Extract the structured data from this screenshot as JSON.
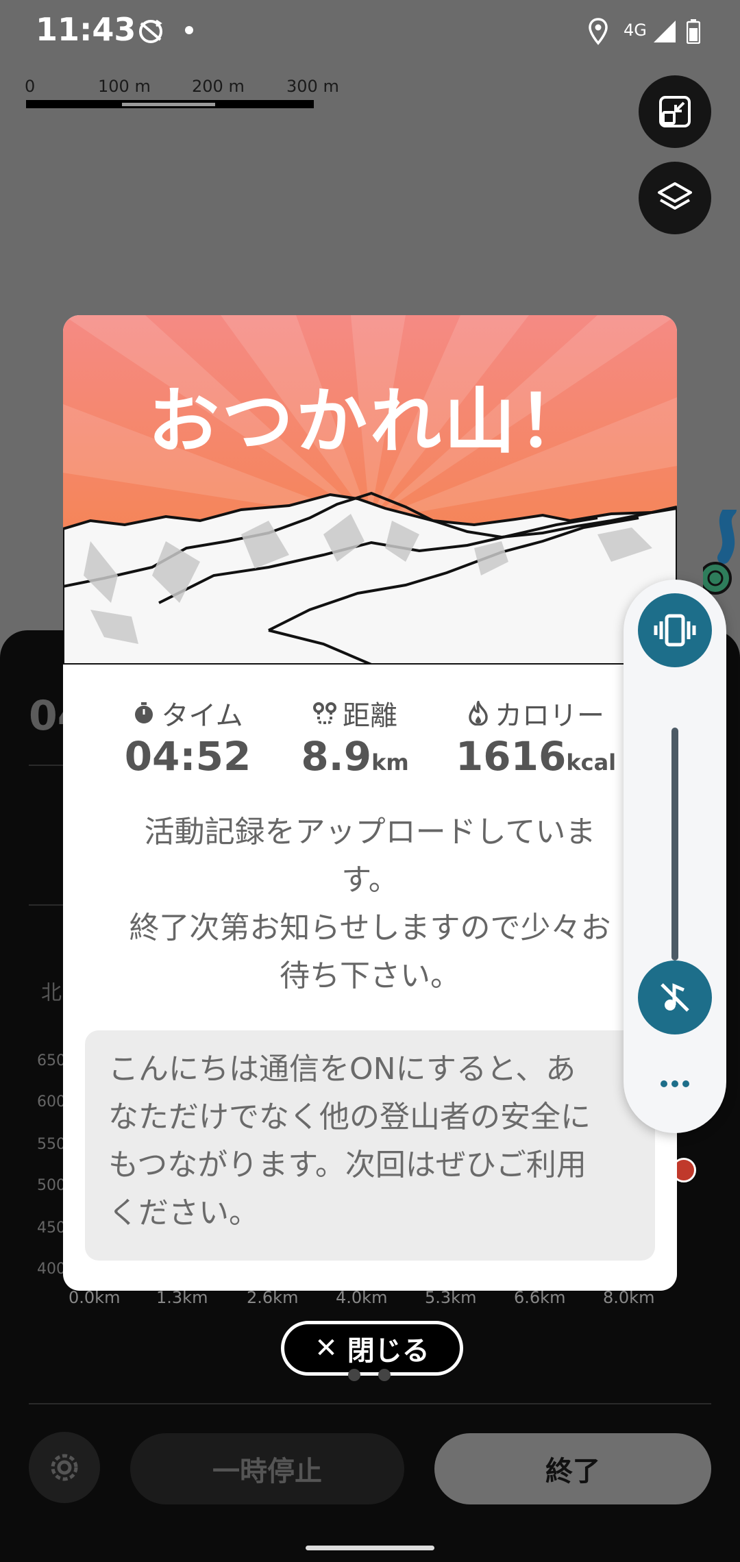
{
  "status_bar": {
    "time": "11:43",
    "network": "4G",
    "icons": [
      "sync-icon",
      "notification-dot",
      "location-icon",
      "signal-icon",
      "battery-icon"
    ]
  },
  "map": {
    "scale_labels": [
      "0",
      "100 m",
      "200 m",
      "300 m"
    ],
    "buttons": [
      "expand-icon",
      "layers-icon"
    ]
  },
  "background_panel": {
    "time_partial": "04",
    "north_label": "北",
    "y_axis_labels": [
      "650",
      "600",
      "550",
      "500",
      "450",
      "400"
    ],
    "x_axis_labels": [
      "0.0km",
      "1.3km",
      "2.6km",
      "4.0km",
      "5.3km",
      "6.6km",
      "8.0km"
    ],
    "pause_label": "一時停止",
    "end_label": "終了"
  },
  "modal": {
    "title": "おつかれ山！",
    "stats": [
      {
        "icon": "timer-icon",
        "label": "タイム",
        "value": "04:52",
        "unit": ""
      },
      {
        "icon": "distance-icon",
        "label": "距離",
        "value": "8.9",
        "unit": "km"
      },
      {
        "icon": "calorie-icon",
        "label": "カロリー",
        "value": "1616",
        "unit": "kcal"
      }
    ],
    "upload_message_lines": [
      "活動記録をアップロードしていま",
      "す。",
      "終了次第お知らせしますので少々お",
      "待ち下さい。"
    ],
    "info_lines": [
      "こんにちは通信をONにすると、あ",
      "なただけでなく他の登山者の安全に",
      "もつながります。次回はぜひご利用",
      "ください。"
    ],
    "close_label": "閉じる"
  },
  "volume_panel": {
    "icons": [
      "vibrate-icon",
      "music-off-icon",
      "more-icon"
    ]
  },
  "colors": {
    "accent_teal": "#1d6e8a",
    "hero_top": "#f58a84",
    "hero_bottom": "#f5823e"
  }
}
